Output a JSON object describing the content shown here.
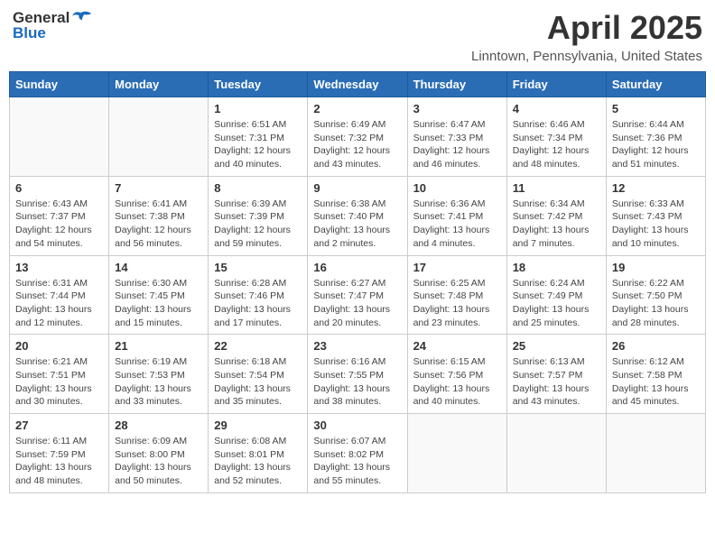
{
  "header": {
    "logo_general": "General",
    "logo_blue": "Blue",
    "title": "April 2025",
    "location": "Linntown, Pennsylvania, United States"
  },
  "calendar": {
    "days_of_week": [
      "Sunday",
      "Monday",
      "Tuesday",
      "Wednesday",
      "Thursday",
      "Friday",
      "Saturday"
    ],
    "weeks": [
      [
        {
          "day": "",
          "info": ""
        },
        {
          "day": "",
          "info": ""
        },
        {
          "day": "1",
          "info": "Sunrise: 6:51 AM\nSunset: 7:31 PM\nDaylight: 12 hours and 40 minutes."
        },
        {
          "day": "2",
          "info": "Sunrise: 6:49 AM\nSunset: 7:32 PM\nDaylight: 12 hours and 43 minutes."
        },
        {
          "day": "3",
          "info": "Sunrise: 6:47 AM\nSunset: 7:33 PM\nDaylight: 12 hours and 46 minutes."
        },
        {
          "day": "4",
          "info": "Sunrise: 6:46 AM\nSunset: 7:34 PM\nDaylight: 12 hours and 48 minutes."
        },
        {
          "day": "5",
          "info": "Sunrise: 6:44 AM\nSunset: 7:36 PM\nDaylight: 12 hours and 51 minutes."
        }
      ],
      [
        {
          "day": "6",
          "info": "Sunrise: 6:43 AM\nSunset: 7:37 PM\nDaylight: 12 hours and 54 minutes."
        },
        {
          "day": "7",
          "info": "Sunrise: 6:41 AM\nSunset: 7:38 PM\nDaylight: 12 hours and 56 minutes."
        },
        {
          "day": "8",
          "info": "Sunrise: 6:39 AM\nSunset: 7:39 PM\nDaylight: 12 hours and 59 minutes."
        },
        {
          "day": "9",
          "info": "Sunrise: 6:38 AM\nSunset: 7:40 PM\nDaylight: 13 hours and 2 minutes."
        },
        {
          "day": "10",
          "info": "Sunrise: 6:36 AM\nSunset: 7:41 PM\nDaylight: 13 hours and 4 minutes."
        },
        {
          "day": "11",
          "info": "Sunrise: 6:34 AM\nSunset: 7:42 PM\nDaylight: 13 hours and 7 minutes."
        },
        {
          "day": "12",
          "info": "Sunrise: 6:33 AM\nSunset: 7:43 PM\nDaylight: 13 hours and 10 minutes."
        }
      ],
      [
        {
          "day": "13",
          "info": "Sunrise: 6:31 AM\nSunset: 7:44 PM\nDaylight: 13 hours and 12 minutes."
        },
        {
          "day": "14",
          "info": "Sunrise: 6:30 AM\nSunset: 7:45 PM\nDaylight: 13 hours and 15 minutes."
        },
        {
          "day": "15",
          "info": "Sunrise: 6:28 AM\nSunset: 7:46 PM\nDaylight: 13 hours and 17 minutes."
        },
        {
          "day": "16",
          "info": "Sunrise: 6:27 AM\nSunset: 7:47 PM\nDaylight: 13 hours and 20 minutes."
        },
        {
          "day": "17",
          "info": "Sunrise: 6:25 AM\nSunset: 7:48 PM\nDaylight: 13 hours and 23 minutes."
        },
        {
          "day": "18",
          "info": "Sunrise: 6:24 AM\nSunset: 7:49 PM\nDaylight: 13 hours and 25 minutes."
        },
        {
          "day": "19",
          "info": "Sunrise: 6:22 AM\nSunset: 7:50 PM\nDaylight: 13 hours and 28 minutes."
        }
      ],
      [
        {
          "day": "20",
          "info": "Sunrise: 6:21 AM\nSunset: 7:51 PM\nDaylight: 13 hours and 30 minutes."
        },
        {
          "day": "21",
          "info": "Sunrise: 6:19 AM\nSunset: 7:53 PM\nDaylight: 13 hours and 33 minutes."
        },
        {
          "day": "22",
          "info": "Sunrise: 6:18 AM\nSunset: 7:54 PM\nDaylight: 13 hours and 35 minutes."
        },
        {
          "day": "23",
          "info": "Sunrise: 6:16 AM\nSunset: 7:55 PM\nDaylight: 13 hours and 38 minutes."
        },
        {
          "day": "24",
          "info": "Sunrise: 6:15 AM\nSunset: 7:56 PM\nDaylight: 13 hours and 40 minutes."
        },
        {
          "day": "25",
          "info": "Sunrise: 6:13 AM\nSunset: 7:57 PM\nDaylight: 13 hours and 43 minutes."
        },
        {
          "day": "26",
          "info": "Sunrise: 6:12 AM\nSunset: 7:58 PM\nDaylight: 13 hours and 45 minutes."
        }
      ],
      [
        {
          "day": "27",
          "info": "Sunrise: 6:11 AM\nSunset: 7:59 PM\nDaylight: 13 hours and 48 minutes."
        },
        {
          "day": "28",
          "info": "Sunrise: 6:09 AM\nSunset: 8:00 PM\nDaylight: 13 hours and 50 minutes."
        },
        {
          "day": "29",
          "info": "Sunrise: 6:08 AM\nSunset: 8:01 PM\nDaylight: 13 hours and 52 minutes."
        },
        {
          "day": "30",
          "info": "Sunrise: 6:07 AM\nSunset: 8:02 PM\nDaylight: 13 hours and 55 minutes."
        },
        {
          "day": "",
          "info": ""
        },
        {
          "day": "",
          "info": ""
        },
        {
          "day": "",
          "info": ""
        }
      ]
    ]
  }
}
